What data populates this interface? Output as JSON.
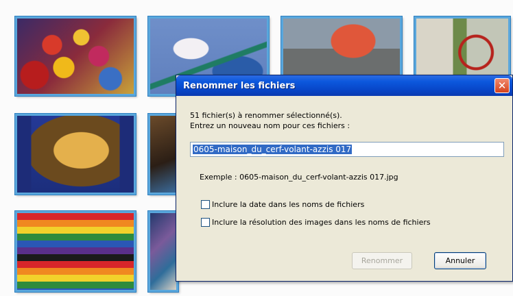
{
  "gallery": {
    "thumbnails": [
      "photo-thumbnail",
      "photo-thumbnail",
      "photo-thumbnail",
      "photo-thumbnail",
      "photo-thumbnail",
      "photo-thumbnail",
      "photo-thumbnail",
      "photo-thumbnail"
    ],
    "selection_border_color": "#5aa7dc"
  },
  "dialog": {
    "title": "Renommer les fichiers",
    "close_icon": "close-icon",
    "message_line1": "51 fichier(s) à renommer sélectionné(s).",
    "message_line2": "Entrez un nouveau nom pour ces fichiers :",
    "input_value": "0605-maison_du_cerf-volant-azzis 017",
    "example": "Exemple : 0605-maison_du_cerf-volant-azzis 017.jpg",
    "option_date": {
      "label": "Inclure la date dans les noms de fichiers",
      "checked": false
    },
    "option_resolution": {
      "label": "Inclure la résolution des images dans les noms de fichiers",
      "checked": false
    },
    "rename_button": {
      "label": "Renommer",
      "enabled": false
    },
    "cancel_button": {
      "label": "Annuler",
      "enabled": true
    },
    "colors": {
      "titlebar": "#0c58dd",
      "body": "#ece9d8",
      "selection": "#316ac5",
      "close": "#d5421c"
    }
  }
}
